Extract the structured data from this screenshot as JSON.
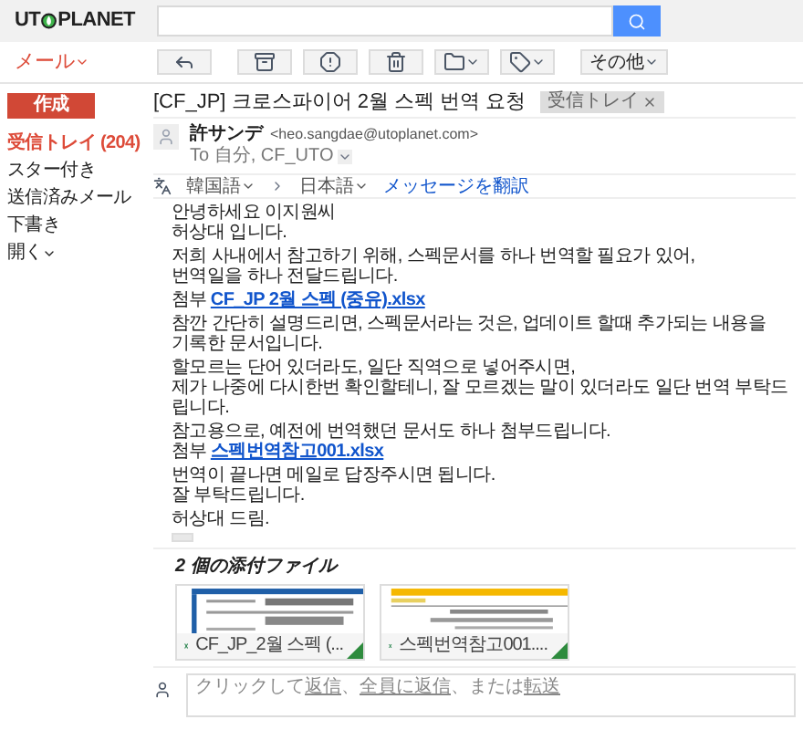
{
  "logo": {
    "left": "UT",
    "right": "PLANET"
  },
  "app_menu": {
    "label": "メール"
  },
  "toolbar": [
    {
      "kind": "reply"
    },
    {
      "kind": "archive"
    },
    {
      "kind": "spam"
    },
    {
      "kind": "trash"
    },
    {
      "kind": "folder"
    },
    {
      "kind": "tag"
    },
    {
      "kind": "more",
      "label": "その他"
    }
  ],
  "compose": {
    "label": "作成"
  },
  "sidebar": {
    "items": [
      {
        "label": "受信トレイ (204)",
        "selected": true
      },
      {
        "label": "スター付き",
        "selected": false
      },
      {
        "label": "送信済みメール",
        "selected": false
      },
      {
        "label": "下書き",
        "selected": false
      },
      {
        "label": "開く",
        "selected": false,
        "dropdown": true
      }
    ]
  },
  "message": {
    "subject": "[CF_JP] 크로스파이어 2월 스펙 번역 요청",
    "label_tag": "受信トレイ",
    "from_name": "許サンデ",
    "from_email": "<heo.sangdae@utoplanet.com>",
    "to": "To 自分, CF_UTO",
    "translate": {
      "from": "韓国語",
      "to": "日本語",
      "action": "メッセージを翻訳"
    },
    "body": [
      {
        "kind": "text",
        "lines": [
          "안녕하세요 이지원씨",
          "허상대 입니다."
        ]
      },
      {
        "kind": "text",
        "lines": [
          "저희 사내에서 참고하기 위해, 스펙문서를 하나 번역할 필요가 있어,",
          "번역일을 하나 전달드립니다."
        ]
      },
      {
        "kind": "attachment",
        "prefix": "첨부",
        "link": "CF_JP 2월 스펙 (중유).xlsx"
      },
      {
        "kind": "text",
        "lines": [
          "참깐 간단히 설명드리면, 스펙문서라는 것은, 업데이트 할때 추가되는 내용을",
          "기록한 문서입니다."
        ]
      },
      {
        "kind": "text",
        "lines": [
          "할모르는 단어 있더라도, 일단 직역으로 넣어주시면,",
          "제가 나중에 다시한번 확인할테니, 잘 모르겠는 말이 있더라도 일단 번역 부탁드립니다."
        ]
      },
      {
        "kind": "text_attachment",
        "lines": [
          "참고용으로, 예전에 번역했던 문서도 하나 첨부드립니다."
        ],
        "prefix": "첨부",
        "link": "스펙번역참고001.xlsx"
      },
      {
        "kind": "text",
        "lines": [
          "번역이 끝나면 메일로 답장주시면 됩니다.",
          "잘 부탁드립니다."
        ]
      },
      {
        "kind": "text",
        "lines": [
          "허상대 드림."
        ]
      }
    ],
    "attachments_title": "2 個の添付ファイル",
    "attachments": [
      {
        "name": "CF_JP_2월 스펙 (..."
      },
      {
        "name": "스펙번역참고001...."
      }
    ],
    "reply": [
      {
        "kind": "text",
        "text": "クリックして"
      },
      {
        "kind": "link",
        "text": "返信"
      },
      {
        "kind": "text",
        "text": "、"
      },
      {
        "kind": "link",
        "text": "全員に返信"
      },
      {
        "kind": "text",
        "text": "、または"
      },
      {
        "kind": "link",
        "text": "転送"
      }
    ]
  }
}
